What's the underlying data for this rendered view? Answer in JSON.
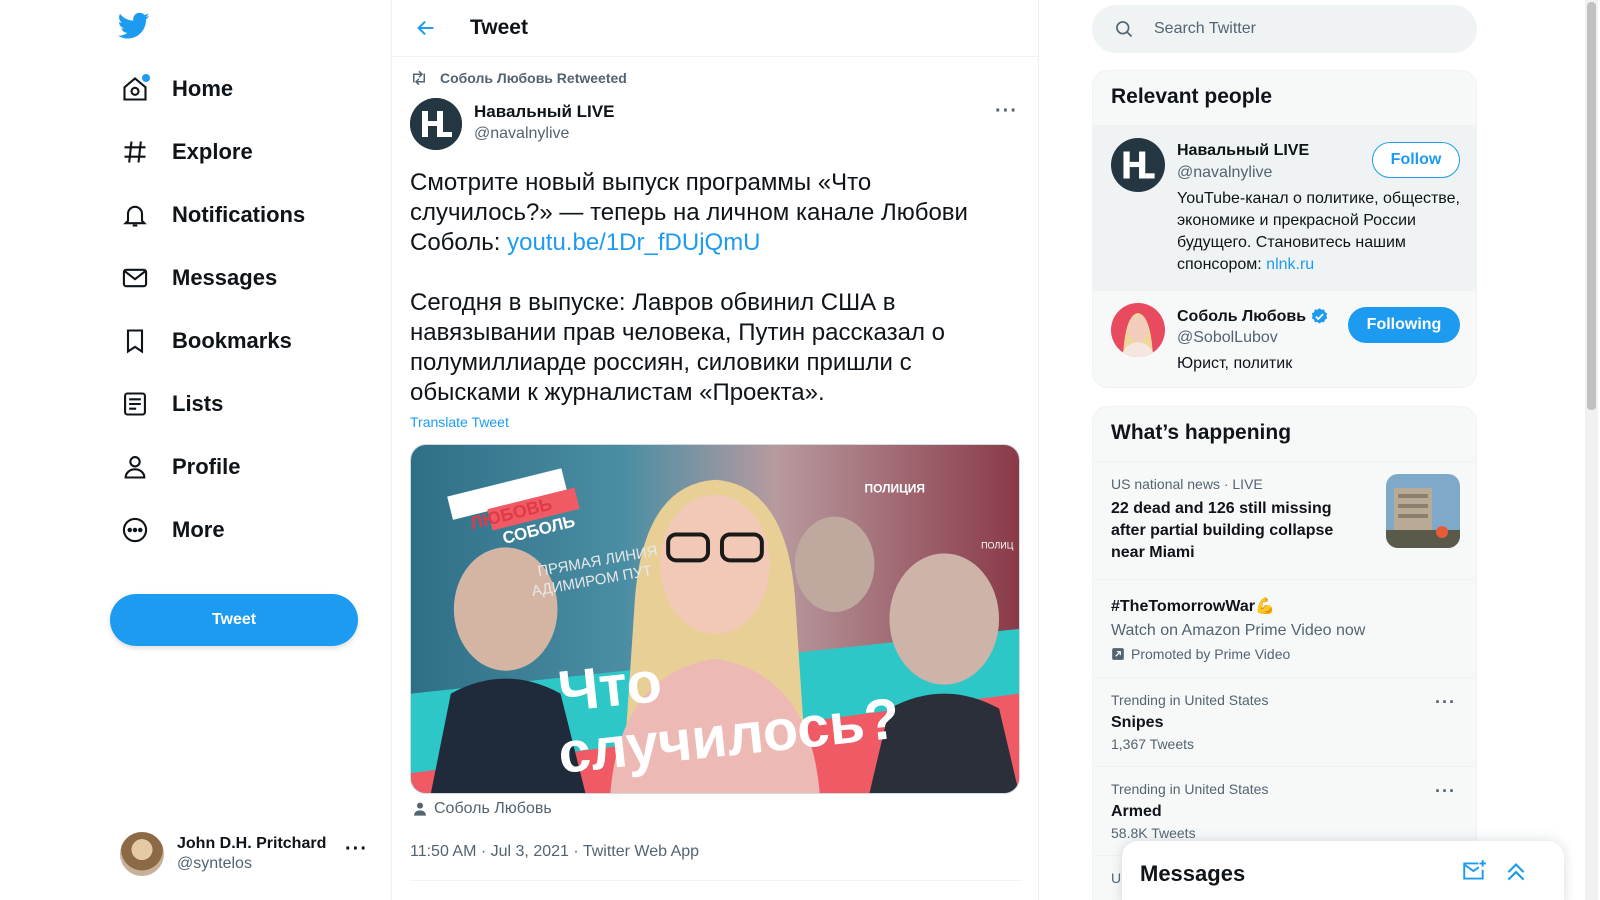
{
  "nav": {
    "items": [
      {
        "label": "Home",
        "icon": "home-icon"
      },
      {
        "label": "Explore",
        "icon": "hashtag-icon"
      },
      {
        "label": "Notifications",
        "icon": "bell-icon"
      },
      {
        "label": "Messages",
        "icon": "envelope-icon"
      },
      {
        "label": "Bookmarks",
        "icon": "bookmark-icon"
      },
      {
        "label": "Lists",
        "icon": "list-icon"
      },
      {
        "label": "Profile",
        "icon": "person-icon"
      },
      {
        "label": "More",
        "icon": "more-circle-icon"
      }
    ],
    "tweet_button": "Tweet",
    "account": {
      "name": "John D.H. Pritchard",
      "handle": "@syntelos"
    }
  },
  "header": {
    "title": "Tweet"
  },
  "tweet": {
    "retweeted_by": "Соболь Любовь Retweeted",
    "author_name": "Навальный LIVE",
    "author_handle": "@navalnylive",
    "text_part1": "Смотрите новый выпуск программы «Что случилось?» — теперь на личном канале Любови Соболь: ",
    "link": "youtu.be/1Dr_fDUjQmU",
    "text_part2": "Сегодня в выпуске: Лавров обвинил США в навязывании прав человека, Путин рассказал о полумиллиарде россиян, силовики пришли с обысками к журналистам «Проекта».",
    "translate": "Translate Tweet",
    "media": {
      "badge_line1": "ЛЮБОВЬ",
      "badge_line2": "СОБОЛЬ",
      "caption_line1": "Что",
      "caption_line2": "случилось?",
      "sign_text": "ПРЯМАЯ ЛИНИЯ",
      "sign_text2": "АДИМИРОМ ПУТ",
      "police": "ПОЛИЦИЯ",
      "police2": "ПОЛИЦ"
    },
    "media_tag": "Соболь Любовь",
    "meta": "11:50 AM · Jul 3, 2021 · Twitter Web App"
  },
  "search": {
    "placeholder": "Search Twitter"
  },
  "relevant": {
    "title": "Relevant people",
    "people": [
      {
        "name": "Навальный LIVE",
        "handle": "@navalnylive",
        "bio": "YouTube-канал о политике, обществе, экономике и прекрасной России будущего. Становитесь нашим спонсором: ",
        "bio_link": "nlnk.ru",
        "button": "Follow"
      },
      {
        "name": "Соболь Любовь",
        "handle": "@SobolLubov",
        "bio": "Юрист, политик",
        "button": "Following"
      }
    ]
  },
  "happening": {
    "title": "What’s happening",
    "items": [
      {
        "meta": "US national news · LIVE",
        "title": "22 dead and 126 still missing after partial building collapse near Miami"
      },
      {
        "title": "#TheTomorrowWar💪",
        "sub": "Watch on Amazon Prime Video now",
        "promo": "Promoted by Prime Video"
      },
      {
        "meta": "Trending in United States",
        "title": "Snipes",
        "sub": "1,367 Tweets"
      },
      {
        "meta": "Trending in United States",
        "title": "Armed",
        "sub": "58.8K Tweets"
      },
      {
        "meta": "U"
      }
    ]
  },
  "messages_drawer": {
    "title": "Messages"
  },
  "colors": {
    "accent": "#1d9bf0",
    "text": "#0f1419",
    "secondary": "#536471"
  }
}
